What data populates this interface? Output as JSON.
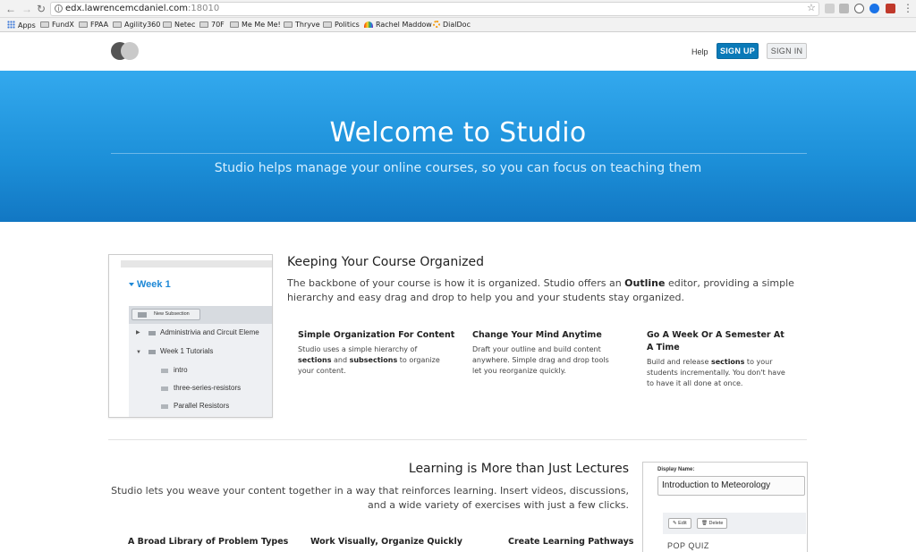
{
  "browser": {
    "url_host": "edx.lawrencemcdaniel.com",
    "url_port": ":18010",
    "bookmarks": [
      {
        "label": "Apps",
        "icon": "apps-grid-icon"
      },
      {
        "label": "FundX",
        "icon": "folder-icon"
      },
      {
        "label": "FPAA",
        "icon": "folder-icon"
      },
      {
        "label": "Agility360",
        "icon": "folder-icon"
      },
      {
        "label": "Netec",
        "icon": "folder-icon"
      },
      {
        "label": "70F",
        "icon": "folder-icon"
      },
      {
        "label": "Me Me Me!",
        "icon": "folder-icon"
      },
      {
        "label": "Thryve",
        "icon": "folder-icon"
      },
      {
        "label": "Politics",
        "icon": "folder-icon"
      },
      {
        "label": "Rachel Maddow",
        "icon": "nbc-peacock-icon"
      },
      {
        "label": "DialDoc",
        "icon": "sun-icon"
      }
    ]
  },
  "header": {
    "help": "Help",
    "sign_up": "SIGN UP",
    "sign_in": "SIGN IN"
  },
  "hero": {
    "title": "Welcome to Studio",
    "subtitle": "Studio helps manage your online courses, so you can focus on teaching them"
  },
  "section1": {
    "title": "Keeping Your Course Organized",
    "desc_a": "The backbone of your course is how it is organized. Studio offers an ",
    "desc_bold": "Outline",
    "desc_b": " editor, providing a simple hierarchy and easy drag and drop to help you and your students stay organized.",
    "screenshot": {
      "week": "Week 1",
      "new_subsection": "New Subsection",
      "rows": [
        "Administrivia and Circuit Eleme",
        "Week 1 Tutorials",
        "intro",
        "three-series-resistors",
        "Parallel Resistors"
      ]
    },
    "columns": [
      {
        "title": "Simple Organization For Content",
        "a": "Studio uses a simple hierarchy of ",
        "b1": "sections",
        "c": " and ",
        "b2": "subsections",
        "d": " to organize your content."
      },
      {
        "title": "Change Your Mind Anytime",
        "body": "Draft your outline and build content anywhere. Simple drag and drop tools let you reorganize quickly."
      },
      {
        "title": "Go A Week Or A Semester At A Time",
        "a": "Build and release ",
        "b1": "sections",
        "c": " to your students incrementally. You don't have to have it all done at once."
      }
    ]
  },
  "section2": {
    "title": "Learning is More than Just Lectures",
    "desc": "Studio lets you weave your content together in a way that reinforces learning. Insert videos, discussions, and a wide variety of exercises with just a few clicks.",
    "columns": [
      "A Broad Library of Problem Types",
      "Work Visually, Organize Quickly",
      "Create Learning Pathways"
    ],
    "screenshot": {
      "display_name_label": "Display Name:",
      "display_name_value": "Introduction to Meteorology",
      "edit": "Edit",
      "delete": "Delete",
      "pop_quiz": "POP QUIZ"
    }
  }
}
